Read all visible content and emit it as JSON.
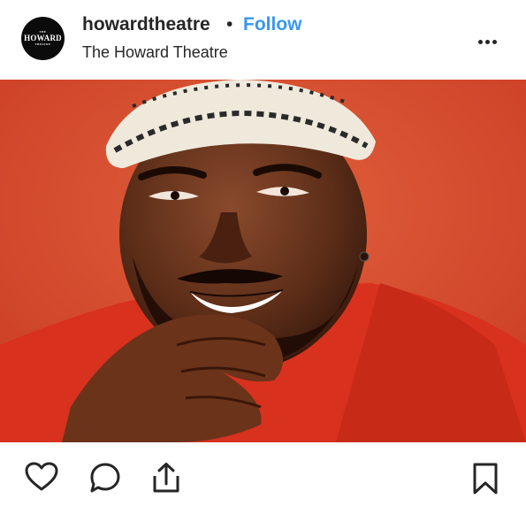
{
  "post": {
    "username": "howardtheatre",
    "separator": "•",
    "follow_label": "Follow",
    "location": "The Howard Theatre",
    "avatar_logo_text": "HOWARD",
    "avatar_logo_small_top": "THE",
    "avatar_logo_small_bottom": "THEATRE"
  },
  "icons": {
    "more": "more-options-icon",
    "like": "heart-icon",
    "comment": "comment-bubble-icon",
    "share": "share-icon",
    "save": "bookmark-icon"
  },
  "colors": {
    "accent": "#3897f0",
    "text": "#262626",
    "photo_background": "#d9482b"
  }
}
